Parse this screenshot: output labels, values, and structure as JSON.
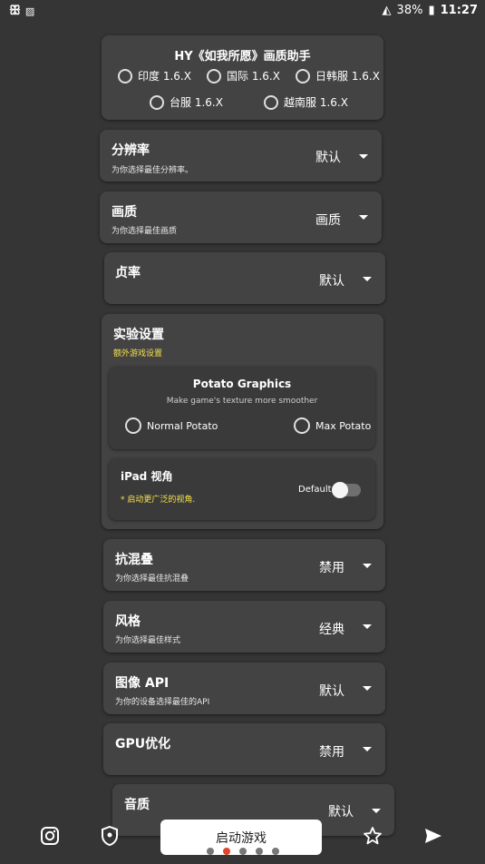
{
  "status_bar": {
    "left_icons": [
      "game-icon",
      "image-icon"
    ],
    "right_text": "38%",
    "time": "11:27"
  },
  "server_card": {
    "title": "HY《如我所愿》画质助手",
    "options": [
      "印度 1.6.X",
      "国际 1.6.X",
      "日韩服 1.6.X",
      "台服 1.6.X",
      "越南服 1.6.X"
    ]
  },
  "resolution": {
    "title": "分辨率",
    "subtitle": "为你选择最佳分辨率。",
    "value": "默认"
  },
  "quality": {
    "title": "画质",
    "subtitle": "为你选择最佳画质",
    "value": "画质"
  },
  "framerate": {
    "title": "贞率",
    "value": "默认"
  },
  "experimental": {
    "title": "实验设置",
    "subtitle": "额外游戏设置",
    "potato": {
      "title": "Potato Graphics",
      "subtitle": "Make game's texture more smoother",
      "options": [
        "Normal Potato",
        "Max Potato"
      ]
    },
    "ipad": {
      "title": "iPad 视角",
      "note": "* 启动更广泛的视角.",
      "toggle_label": "Default"
    }
  },
  "antialias": {
    "title": "抗混叠",
    "subtitle": "为你选择最佳抗混叠",
    "value": "禁用"
  },
  "style": {
    "title": "风格",
    "subtitle": "为你选择最佳样式",
    "value": "经典"
  },
  "graphics_api": {
    "title": "图像 API",
    "subtitle": "为你的设备选择最佳的API",
    "value": "默认"
  },
  "gpu": {
    "title": "GPU优化",
    "value": "禁用"
  },
  "audio": {
    "title": "音质",
    "value": "默认"
  },
  "bottom": {
    "start_label": "启动游戏",
    "icons": [
      "instagram-icon",
      "shield-icon",
      "star-icon",
      "send-icon"
    ],
    "page_count": 5,
    "active_page": 2
  }
}
